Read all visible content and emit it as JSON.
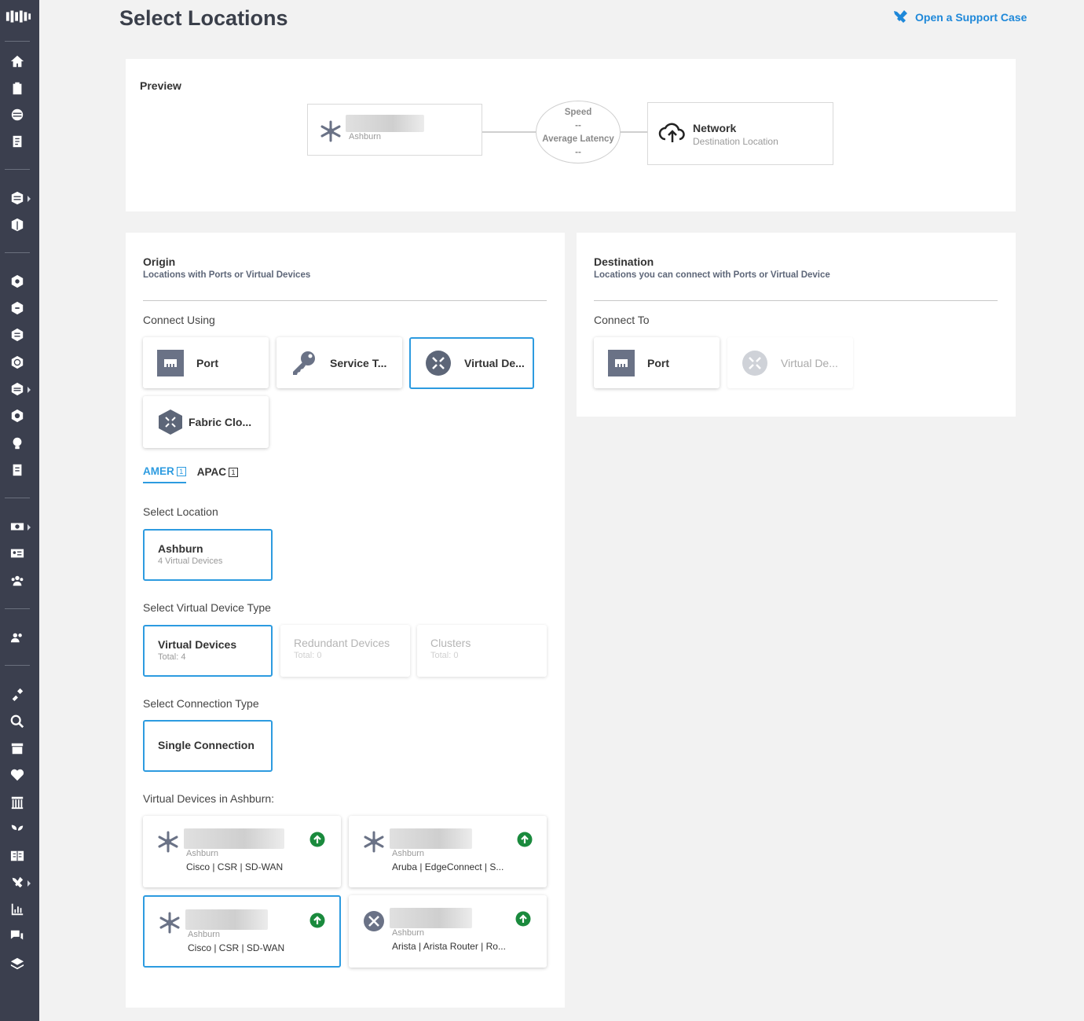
{
  "page": {
    "title": "Select Locations",
    "support_label": "Open a Support Case"
  },
  "colors": {
    "accent": "#2d9be0",
    "sidebar": "#3b3f4e",
    "status_up": "#1a8a3d"
  },
  "sidebar": {
    "icons": [
      "logo-icon",
      "home-icon",
      "clipboard-icon",
      "globe-icon",
      "document-icon",
      "cube-icon",
      "box-icon",
      "hexagon-icon",
      "hexagon-icon",
      "hexagon-icon",
      "hexagon-icon",
      "hexagon-icon",
      "hexagon-icon",
      "lightbulb-icon",
      "document-icon",
      "dollar-icon",
      "id-card-icon",
      "users-icon",
      "team-icon",
      "plug-icon",
      "search-icon",
      "store-icon",
      "heartbeat-icon",
      "building-icon",
      "plant-icon",
      "book-icon",
      "tools-icon",
      "chart-icon",
      "chat-icon",
      "layers-icon"
    ]
  },
  "preview": {
    "title": "Preview",
    "origin_location": "Ashburn",
    "speed_label": "Speed",
    "speed_value": "--",
    "latency_label": "Average Latency",
    "latency_value": "--",
    "dest_title": "Network",
    "dest_sub": "Destination Location"
  },
  "origin": {
    "title": "Origin",
    "subtitle": "Locations with Ports or Virtual Devices",
    "connect_label": "Connect Using",
    "connect_options": [
      "Port",
      "Service T...",
      "Virtual De...",
      "Fabric Clo..."
    ],
    "tabs": [
      {
        "label": "AMER",
        "count": "1"
      },
      {
        "label": "APAC",
        "count": "1"
      }
    ],
    "select_location_label": "Select Location",
    "location": {
      "name": "Ashburn",
      "detail": "4 Virtual Devices"
    },
    "vd_type_label": "Select Virtual Device Type",
    "vd_types": [
      {
        "name": "Virtual Devices",
        "total": "Total: 4"
      },
      {
        "name": "Redundant Devices",
        "total": "Total: 0"
      },
      {
        "name": "Clusters",
        "total": "Total: 0"
      }
    ],
    "conn_type_label": "Select Connection Type",
    "conn_type": "Single Connection",
    "devices_label": "Virtual Devices in Ashburn:",
    "devices": [
      {
        "location": "Ashburn",
        "desc": "Cisco | CSR | SD-WAN"
      },
      {
        "location": "Ashburn",
        "desc": "Aruba | EdgeConnect | S..."
      },
      {
        "location": "Ashburn",
        "desc": "Cisco | CSR | SD-WAN"
      },
      {
        "location": "Ashburn",
        "desc": "Arista | Arista Router | Ro..."
      }
    ]
  },
  "destination": {
    "title": "Destination",
    "subtitle": "Locations you can connect with Ports or Virtual Device",
    "connect_label": "Connect To",
    "options": [
      "Port",
      "Virtual De..."
    ]
  }
}
